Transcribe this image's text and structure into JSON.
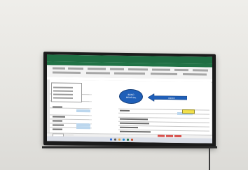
{
  "scene": {
    "description_colors": {
      "wall": "#e9e8e4",
      "tv_bezel": "#1b1b1b",
      "excel_green": "#217346",
      "shape_blue": "#1f5fb8",
      "highlight_yellow": "#f2e04a"
    }
  },
  "screen": {
    "app": "Excel",
    "oval_label_line1": "BONO",
    "oval_label_line2": "MENSUAL",
    "arrow_label": "INICIO"
  }
}
